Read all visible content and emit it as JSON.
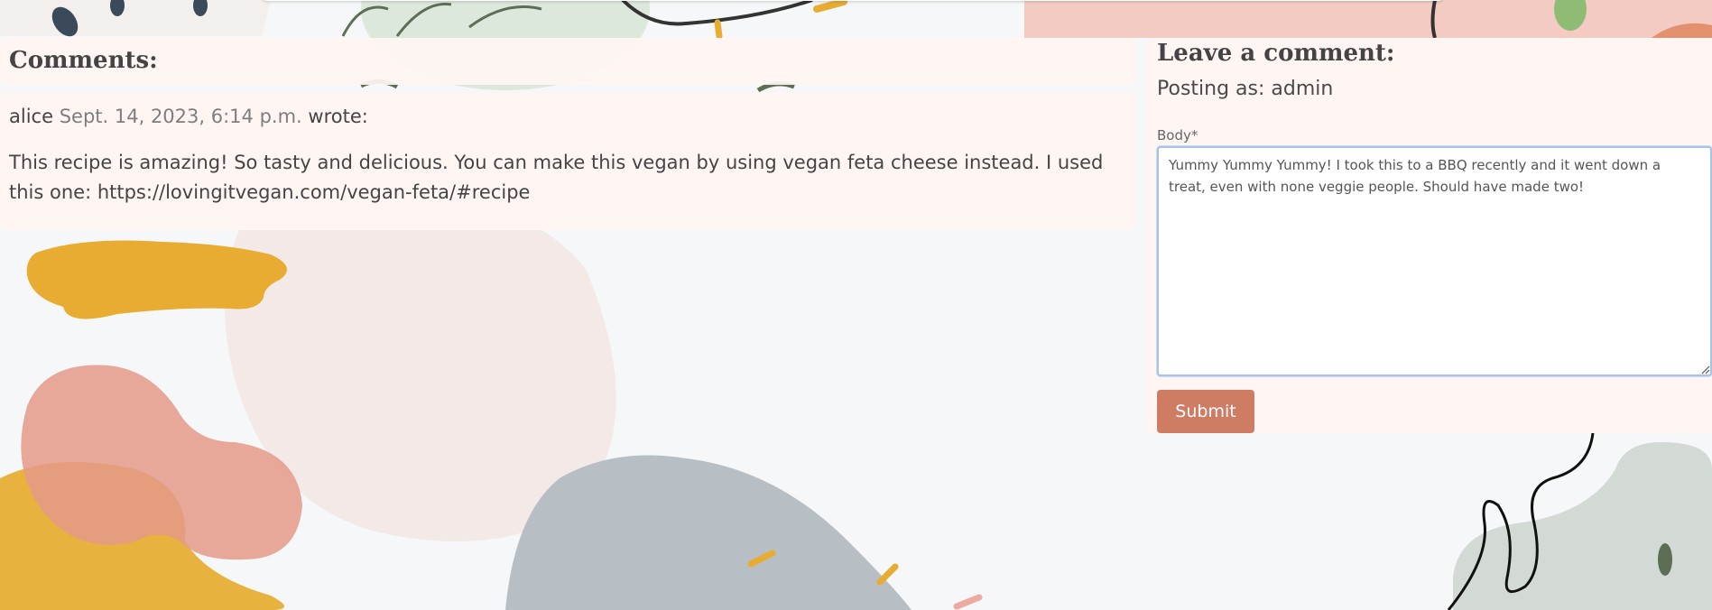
{
  "comments": {
    "heading": "Comments:",
    "items": [
      {
        "author": "alice",
        "date": "Sept. 14, 2023, 6:14 p.m.",
        "wrote": "wrote:",
        "body": "This recipe is amazing! So tasty and delicious. You can make this vegan by using vegan feta cheese instead. I used this one: https://lovingitvegan.com/vegan-feta/#recipe"
      }
    ]
  },
  "form": {
    "heading": "Leave a comment:",
    "posting_as": "Posting as: admin",
    "body_label": "Body*",
    "body_value": "Yummy Yummy Yummy! I took this to a BBQ recently and it went down a treat, even with none veggie people. Should have made two!",
    "submit_label": "Submit"
  },
  "colors": {
    "panel": "#fff5f3",
    "submit": "#cf7c65",
    "focus_border": "#a4c3ee"
  }
}
